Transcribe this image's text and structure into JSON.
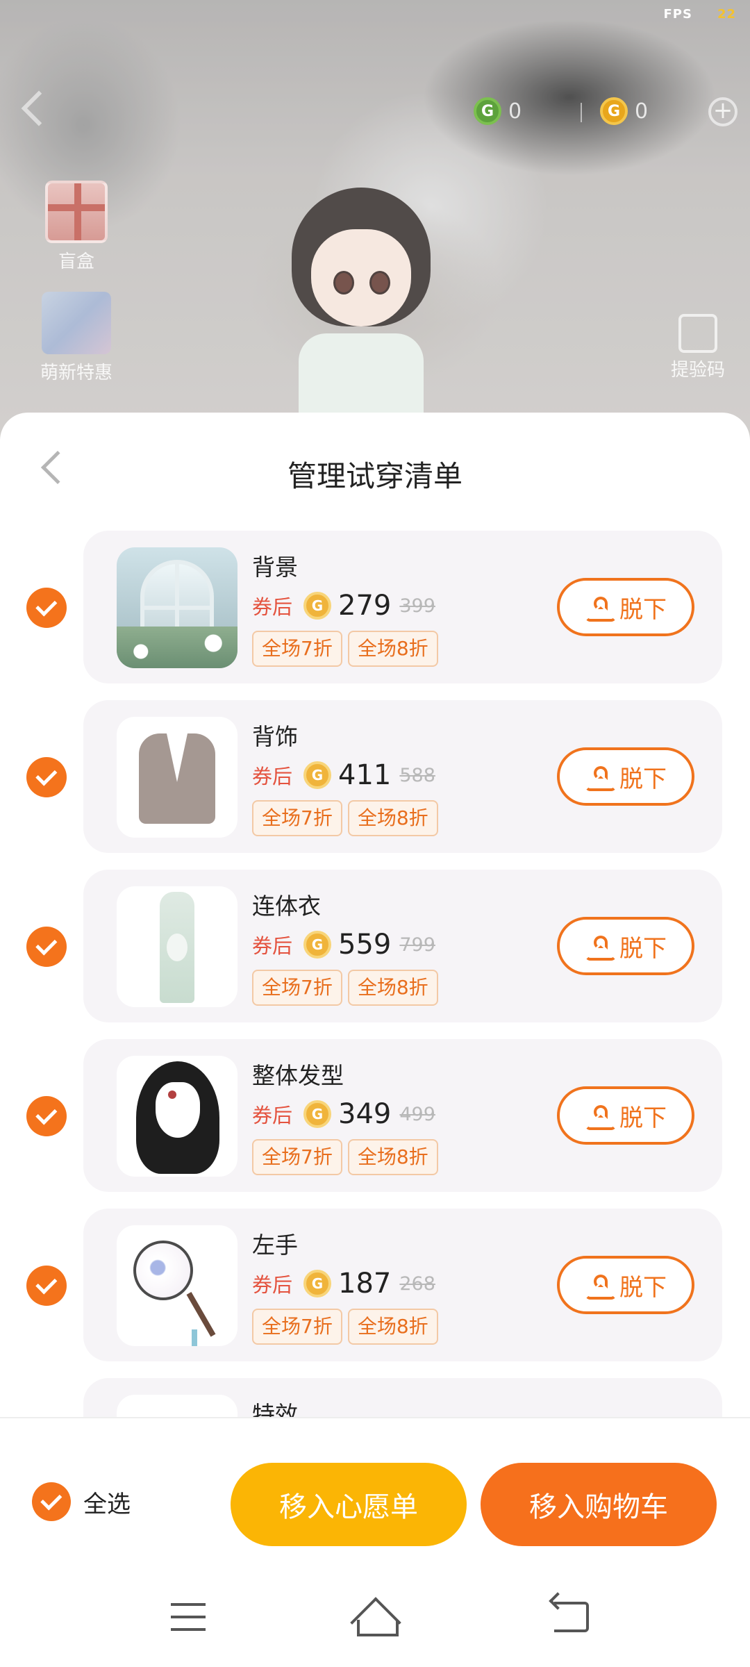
{
  "status": {
    "fps_label": "FPS",
    "fps_value": "22"
  },
  "scene": {
    "currency_green": "0",
    "currency_gold": "0",
    "blind_box_label": "盲盒",
    "newbie_label": "萌新特惠",
    "verify_label": "提验码",
    "coin_letter": "G"
  },
  "sheet": {
    "title": "管理试穿清单",
    "coupon_label": "券后",
    "takeoff_label": "脱下",
    "tag_1": "全场7折",
    "tag_2": "全场8折",
    "items": [
      {
        "name": "背景",
        "price": "279",
        "original": "399"
      },
      {
        "name": "背饰",
        "price": "411",
        "original": "588"
      },
      {
        "name": "连体衣",
        "price": "559",
        "original": "799"
      },
      {
        "name": "整体发型",
        "price": "349",
        "original": "499"
      },
      {
        "name": "左手",
        "price": "187",
        "original": "268"
      },
      {
        "name": "特效"
      }
    ]
  },
  "bottom_bar": {
    "select_all_label": "全选",
    "wishlist_button": "移入心愿单",
    "cart_button": "移入购物车"
  },
  "colors": {
    "accent_orange": "#f4731c",
    "wishlist_yellow": "#fbb505",
    "coupon_red": "#e4533f"
  }
}
